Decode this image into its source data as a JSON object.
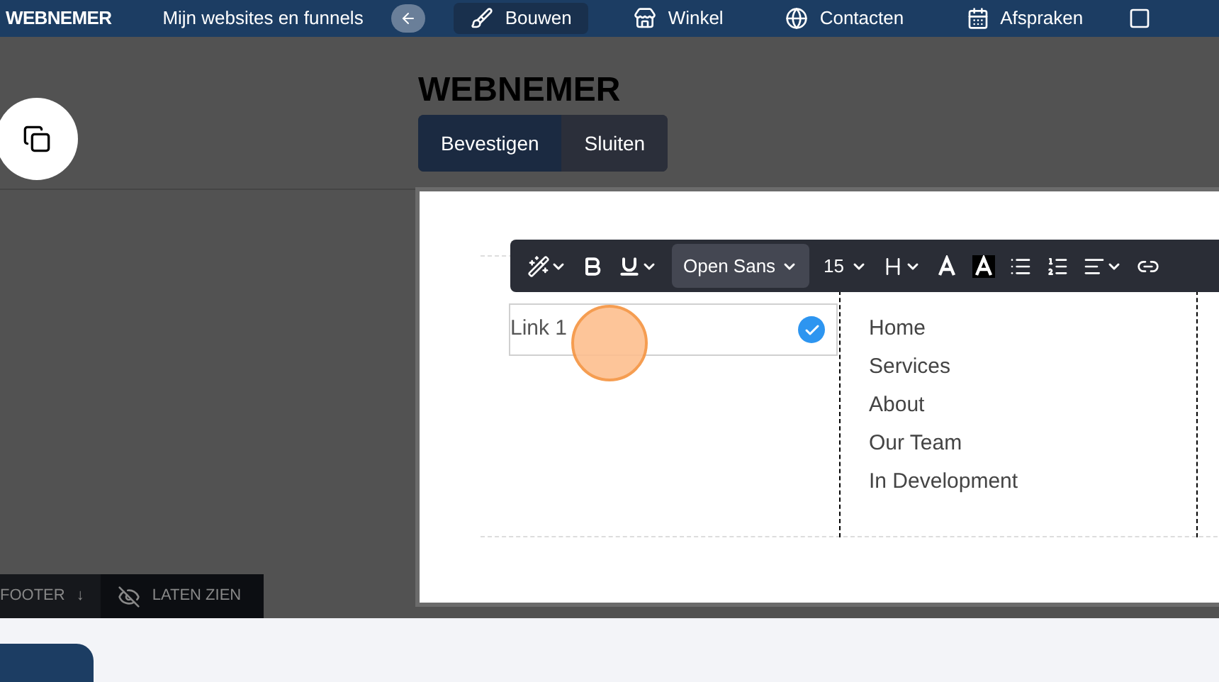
{
  "nav": {
    "brand": "WEBNEMER",
    "sites_link": "Mijn websites en funnels",
    "items": [
      {
        "label": "Bouwen",
        "selected": true
      },
      {
        "label": "Winkel",
        "selected": false
      },
      {
        "label": "Contacten",
        "selected": false
      },
      {
        "label": "Afspraken",
        "selected": false
      }
    ]
  },
  "editor": {
    "heading": "WEBNEMER",
    "actions": [
      {
        "label": "Bevestigen",
        "selected": true
      },
      {
        "label": "Sluiten",
        "selected": false
      }
    ],
    "toolbar": {
      "font": "Open Sans",
      "size": "15"
    },
    "link_field": {
      "value": "Link 1",
      "checked": true
    },
    "menu": [
      "Home",
      "Services",
      "About",
      "Our Team",
      "In Development"
    ]
  },
  "footer_bar": {
    "label": "FOOTER",
    "arrow": "↓",
    "toggle": "LATEN ZIEN"
  }
}
